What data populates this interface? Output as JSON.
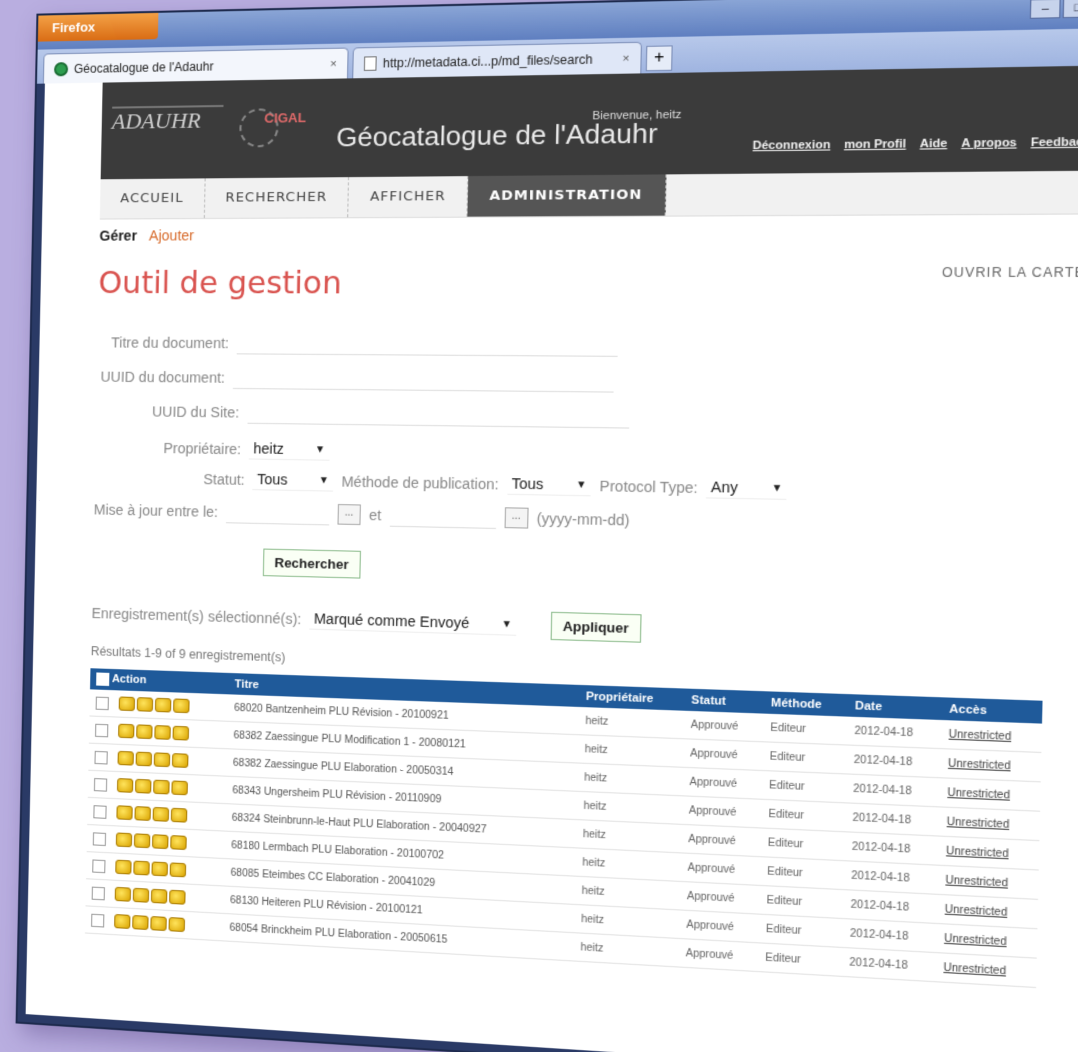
{
  "browser": {
    "app_button": "Firefox",
    "tabs": [
      {
        "label": "Géocatalogue de l'Adauhr",
        "close": "×"
      },
      {
        "label": "http://metadata.ci...p/md_files/search",
        "close": "×"
      }
    ],
    "new_tab": "+",
    "win_min": "–",
    "win_max": "□",
    "win_close": "✕"
  },
  "header": {
    "logo_left": "ADAUHR",
    "logo_right": "CIGAL",
    "title": "Géocatalogue de l'Adauhr",
    "welcome": "Bienvenue, heitz",
    "links": [
      "Déconnexion",
      "mon Profil",
      "Aide",
      "A propos",
      "Feedback"
    ]
  },
  "nav": {
    "items": [
      "ACCUEIL",
      "RECHERCHER",
      "AFFICHER",
      "ADMINISTRATION"
    ],
    "active": "ADMINISTRATION",
    "open_map": "OUVRIR LA CARTE"
  },
  "subnav": {
    "manage": "Gérer",
    "add": "Ajouter"
  },
  "page_title": "Outil de gestion",
  "form": {
    "doc_title_label": "Titre du document:",
    "doc_uuid_label": "UUID du document:",
    "site_uuid_label": "UUID du Site:",
    "owner_label": "Propriétaire:",
    "owner_value": "heitz",
    "status_label": "Statut:",
    "status_value": "Tous",
    "pub_method_label": "Méthode de publication:",
    "pub_method_value": "Tous",
    "protocol_label": "Protocol Type:",
    "protocol_value": "Any",
    "updated_label": "Mise à jour entre le:",
    "and_label": "et",
    "date_btn": "...",
    "date_format": "(yyyy-mm-dd)",
    "search_button": "Rechercher",
    "selected_label": "Enregistrement(s) sélectionné(s):",
    "selected_action": "Marqué comme Envoyé",
    "apply_button": "Appliquer"
  },
  "results": {
    "summary": "Résultats 1-9 of 9 enregistrement(s)",
    "columns": [
      "Action",
      "Titre",
      "Propriétaire",
      "Statut",
      "Méthode",
      "Date",
      "Accès"
    ],
    "rows": [
      {
        "title": "68020 Bantzenheim PLU Révision - 20100921",
        "owner": "heitz",
        "status": "Approuvé",
        "method": "Editeur",
        "date": "2012-04-18",
        "access": "Unrestricted"
      },
      {
        "title": "68382 Zaessingue PLU Modification 1 - 20080121",
        "owner": "heitz",
        "status": "Approuvé",
        "method": "Editeur",
        "date": "2012-04-18",
        "access": "Unrestricted"
      },
      {
        "title": "68382 Zaessingue PLU Elaboration - 20050314",
        "owner": "heitz",
        "status": "Approuvé",
        "method": "Editeur",
        "date": "2012-04-18",
        "access": "Unrestricted"
      },
      {
        "title": "68343 Ungersheim PLU Révision - 20110909",
        "owner": "heitz",
        "status": "Approuvé",
        "method": "Editeur",
        "date": "2012-04-18",
        "access": "Unrestricted"
      },
      {
        "title": "68324 Steinbrunn-le-Haut PLU Elaboration - 20040927",
        "owner": "heitz",
        "status": "Approuvé",
        "method": "Editeur",
        "date": "2012-04-18",
        "access": "Unrestricted"
      },
      {
        "title": "68180 Lermbach PLU Elaboration - 20100702",
        "owner": "heitz",
        "status": "Approuvé",
        "method": "Editeur",
        "date": "2012-04-18",
        "access": "Unrestricted"
      },
      {
        "title": "68085 Eteimbes CC Elaboration - 20041029",
        "owner": "heitz",
        "status": "Approuvé",
        "method": "Editeur",
        "date": "2012-04-18",
        "access": "Unrestricted"
      },
      {
        "title": "68130 Heiteren PLU Révision - 20100121",
        "owner": "heitz",
        "status": "Approuvé",
        "method": "Editeur",
        "date": "2012-04-18",
        "access": "Unrestricted"
      },
      {
        "title": "68054 Brinckheim PLU Elaboration - 20050615",
        "owner": "heitz",
        "status": "Approuvé",
        "method": "Editeur",
        "date": "2012-04-18",
        "access": "Unrestricted"
      }
    ]
  },
  "colors": {
    "background": "#b9aee0",
    "accent_title": "#d9534f",
    "table_header": "#1f5a9a",
    "header_bg": "#3b3b3b"
  },
  "icons": [
    "globe-icon",
    "page-icon",
    "edit-icon",
    "copy-icon",
    "delete-icon",
    "privileges-icon"
  ]
}
